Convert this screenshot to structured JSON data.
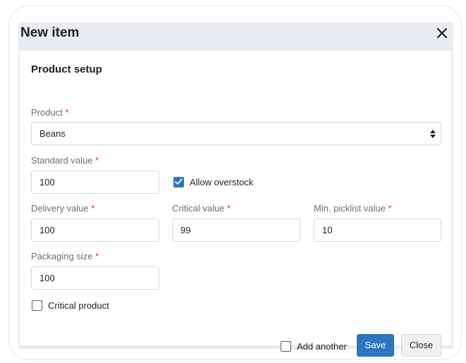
{
  "dialog": {
    "title": "New item",
    "close_icon": "close-icon"
  },
  "form": {
    "section_title": "Product setup",
    "required_marker": "*",
    "product": {
      "label": "Product",
      "value": "Beans"
    },
    "standard_value": {
      "label": "Standard value",
      "value": "100"
    },
    "allow_overstock": {
      "label": "Allow overstock",
      "checked": true
    },
    "delivery_value": {
      "label": "Delivery value",
      "value": "100"
    },
    "critical_value": {
      "label": "Critical value",
      "value": "99"
    },
    "min_picklist_value": {
      "label": "Min. picklist value",
      "value": "10"
    },
    "packaging_size": {
      "label": "Packaging size",
      "value": "100"
    },
    "critical_product": {
      "label": "Critical product",
      "checked": false
    }
  },
  "footer": {
    "add_another": {
      "label": "Add another",
      "checked": false
    },
    "save_label": "Save",
    "close_label": "Close"
  },
  "colors": {
    "primary": "#2f74c0",
    "required": "#d9342b",
    "header_bg": "#e9edf1"
  }
}
